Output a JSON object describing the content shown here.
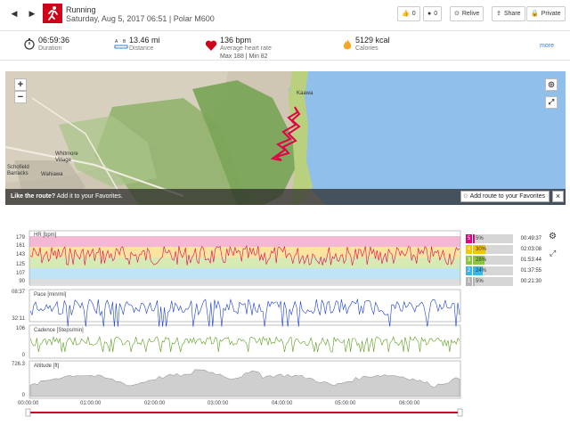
{
  "header": {
    "sport": "Running",
    "subtitle": "Saturday, Aug 5, 2017 06:51 | Polar M600",
    "like_count": "0",
    "comment_count": "0",
    "relive_label": "Relive",
    "share_label": "Share",
    "private_label": "Private"
  },
  "summary": {
    "duration_value": "06:59:36",
    "duration_label": "Duration",
    "distance_value": "13.46 mi",
    "distance_label": "Distance",
    "hr_value": "136 bpm",
    "hr_label": "Average heart rate",
    "hr_detail": "Max 188  |  Min 82",
    "calories_value": "5129 kcal",
    "calories_label": "Calories",
    "more_label": "more"
  },
  "map": {
    "zoom_in": "+",
    "zoom_out": "−",
    "place_1": "Kaawa",
    "place_2": "Whitmore Village",
    "place_3": "Wahiawa",
    "place_4": "Schofield Barracks",
    "like_prompt_bold": "Like the route?",
    "like_prompt_rest": "Add it to your Favorites.",
    "add_route_label": "Add route to your Favorites",
    "close_label": "×"
  },
  "charts": {
    "hr": {
      "label": "HR [bpm]",
      "ticks": [
        "179",
        "161",
        "143",
        "125",
        "107",
        "90"
      ],
      "zones": [
        {
          "zone": "5",
          "pct": "5%",
          "time": "00:49:37",
          "fraction": 0.05,
          "color": "#e5007e"
        },
        {
          "zone": "4",
          "pct": "30%",
          "time": "02:03:08",
          "fraction": 0.3,
          "color": "#f7c400"
        },
        {
          "zone": "3",
          "pct": "28%",
          "time": "01:53:44",
          "fraction": 0.28,
          "color": "#8cc63f"
        },
        {
          "zone": "2",
          "pct": "24%",
          "time": "01:37:55",
          "fraction": 0.24,
          "color": "#3bb5e8"
        },
        {
          "zone": "1",
          "pct": "5%",
          "time": "00:21:30",
          "fraction": 0.05,
          "color": "#b3b3b3"
        }
      ]
    },
    "pace": {
      "label": "Pace [min/mi]",
      "top": "08:37",
      "bottom": "32:11"
    },
    "cadence": {
      "label": "Cadence [Steps/min]",
      "top": "106",
      "bottom": "0"
    },
    "altitude": {
      "label": "Altitude [ft]",
      "top": "726.3",
      "bottom": "0"
    },
    "time_axis": [
      "00:00:00",
      "01:00:00",
      "02:00:00",
      "03:00:00",
      "04:00:00",
      "05:00:00",
      "06:00:00"
    ]
  }
}
